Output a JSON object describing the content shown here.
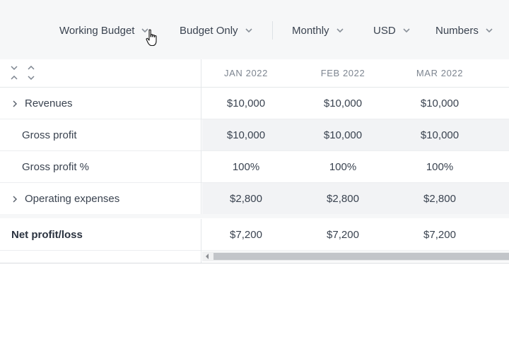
{
  "toolbar": {
    "budget": {
      "label": "Working Budget",
      "icon": "chevron-down-icon"
    },
    "scenario": {
      "label": "Budget Only",
      "icon": "chevron-down-icon"
    },
    "period": {
      "label": "Monthly",
      "icon": "chevron-down-icon"
    },
    "currency": {
      "label": "USD",
      "icon": "chevron-down-icon"
    },
    "format": {
      "label": "Numbers",
      "icon": "chevron-down-icon"
    }
  },
  "table": {
    "columns": [
      "JAN 2022",
      "FEB 2022",
      "MAR 2022"
    ],
    "rows": [
      {
        "label": "Revenues",
        "expandable": true,
        "values": [
          "$10,000",
          "$10,000",
          "$10,000"
        ]
      },
      {
        "label": "Gross profit",
        "expandable": false,
        "values": [
          "$10,000",
          "$10,000",
          "$10,000"
        ]
      },
      {
        "label": "Gross profit %",
        "expandable": false,
        "values": [
          "100%",
          "100%",
          "100%"
        ]
      },
      {
        "label": "Operating expenses",
        "expandable": true,
        "values": [
          "$2,800",
          "$2,800",
          "$2,800"
        ]
      }
    ],
    "total": {
      "label": "Net profit/loss",
      "values": [
        "$7,200",
        "$7,200",
        "$7,200"
      ]
    }
  },
  "colors": {
    "toolbar_bg": "#f6f7f8",
    "alt_row_bg": "#f2f3f5",
    "scroll_thumb": "#c2c5c9"
  }
}
